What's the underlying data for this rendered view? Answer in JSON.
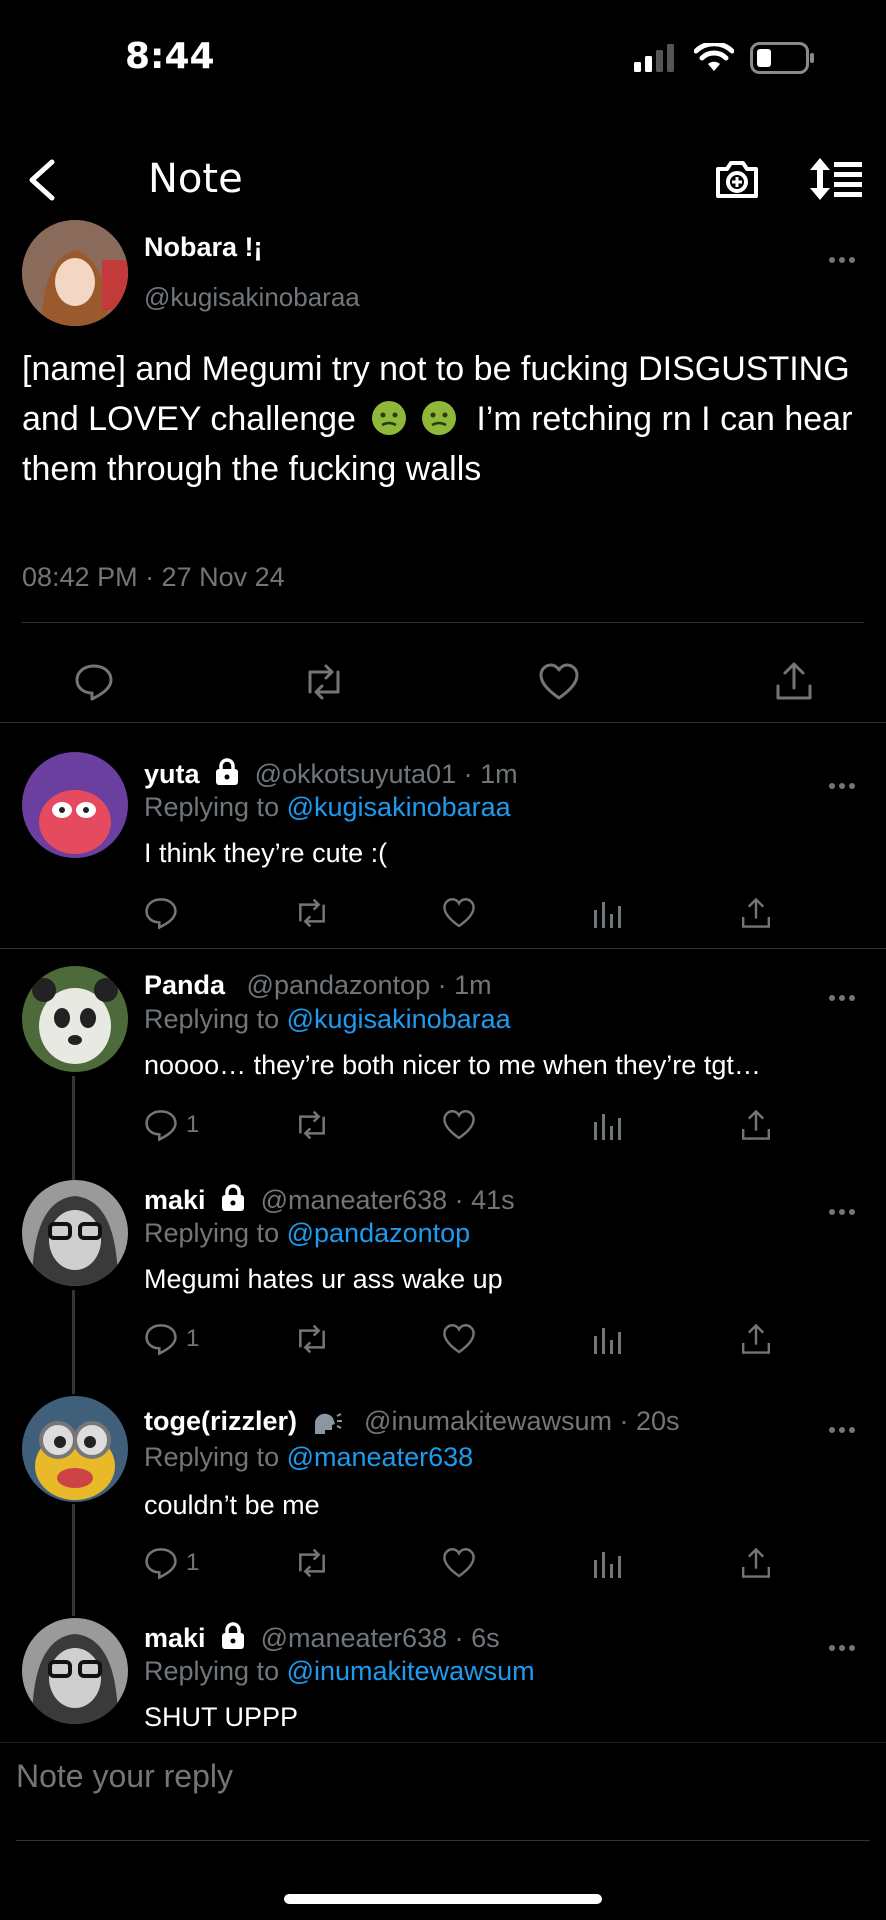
{
  "status": {
    "time": "8:44"
  },
  "nav": {
    "title": "Note"
  },
  "main_post": {
    "name": "Nobara !¡",
    "handle": "@kugisakinobaraa",
    "text_before_emoji": "[name] and Megumi try not to be fucking DISGUSTING and LOVEY challenge",
    "text_after_emoji": "I’m retching rn I can hear them through the fucking walls",
    "timestamp": "08:42 PM · 27 Nov 24"
  },
  "replies": [
    {
      "name": "yuta",
      "handle": "@okkotsuyuta01 · 1m",
      "replying_prefix": "Replying to",
      "replying_to": "@kugisakinobaraa",
      "text": "I think they’re cute :(",
      "reply_count": ""
    },
    {
      "name": "Panda",
      "handle": "@pandazontop · 1m",
      "replying_prefix": "Replying to",
      "replying_to": "@kugisakinobaraa",
      "text": "noooo… they’re both nicer to me when they’re tgt…",
      "reply_count": "1"
    },
    {
      "name": "maki",
      "handle": "@maneater638 · 41s",
      "replying_prefix": "Replying to",
      "replying_to": "@pandazontop",
      "text": "Megumi hates ur ass wake up",
      "reply_count": "1"
    },
    {
      "name": "toge(rizzler)",
      "handle": "@inumakitewawsum · 20s",
      "replying_prefix": "Replying to",
      "replying_to": "@maneater638",
      "text": "couldn’t be me",
      "reply_count": "1"
    },
    {
      "name": "maki",
      "handle": "@maneater638 · 6s",
      "replying_prefix": "Replying to",
      "replying_to": "@inumakitewawsum",
      "text": "SHUT UPPP",
      "reply_count": ""
    }
  ],
  "reply_bar": {
    "placeholder": "Note your reply"
  },
  "colors": {
    "link": "#1d9bf0",
    "muted": "#71767b",
    "background": "#000000"
  }
}
